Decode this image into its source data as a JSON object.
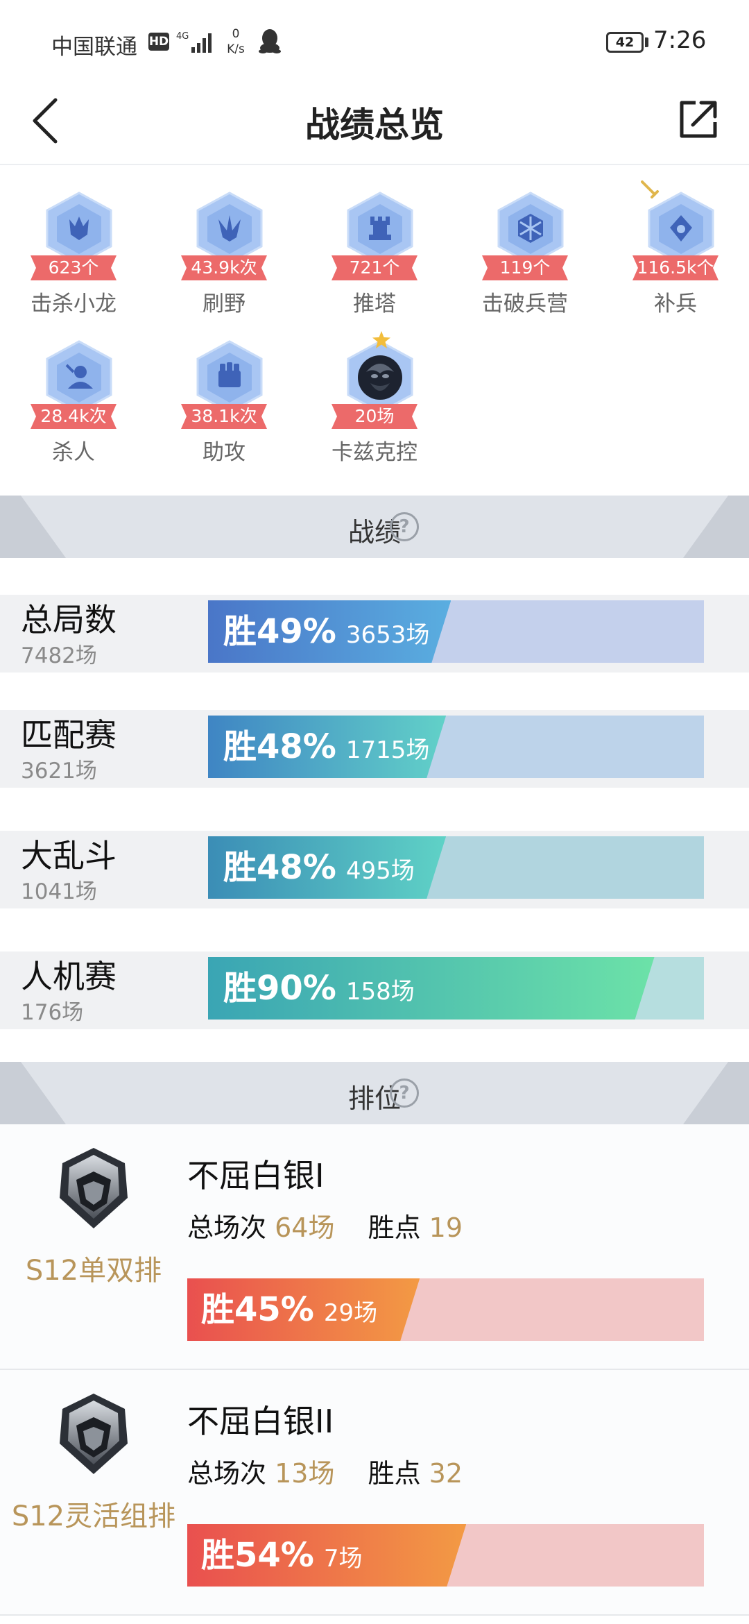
{
  "status_bar": {
    "carrier": "中国联通",
    "hd": "HD",
    "network_type": "4G",
    "net_speed_value": "0",
    "net_speed_unit": "K/s",
    "battery": "42",
    "time": "7:26"
  },
  "nav": {
    "title": "战绩总览"
  },
  "badges": [
    {
      "value": "623个",
      "label": "击杀小龙",
      "icon": "dragon-icon"
    },
    {
      "value": "43.9k次",
      "label": "刷野",
      "icon": "jungle-icon"
    },
    {
      "value": "721个",
      "label": "推塔",
      "icon": "tower-icon"
    },
    {
      "value": "119个",
      "label": "击破兵营",
      "icon": "barracks-icon"
    },
    {
      "value": "116.5k个",
      "label": "补兵",
      "icon": "minion-icon"
    },
    {
      "value": "28.4k次",
      "label": "杀人",
      "icon": "kill-icon"
    },
    {
      "value": "38.1k次",
      "label": "助攻",
      "icon": "assist-icon"
    },
    {
      "value": "20场",
      "label": "卡兹克控",
      "icon": "hero-portrait-icon"
    }
  ],
  "stats_section": {
    "title": "战绩",
    "rows": [
      {
        "name": "总局数",
        "total": "7482场",
        "win_label": "胜49%",
        "wins": "3653场",
        "win_rate": 0.49
      },
      {
        "name": "匹配赛",
        "total": "3621场",
        "win_label": "胜48%",
        "wins": "1715场",
        "win_rate": 0.48
      },
      {
        "name": "大乱斗",
        "total": "1041场",
        "win_label": "胜48%",
        "wins": "495场",
        "win_rate": 0.48
      },
      {
        "name": "人机赛",
        "total": "176场",
        "win_label": "胜90%",
        "wins": "158场",
        "win_rate": 0.9
      }
    ]
  },
  "rank_section": {
    "title": "排位",
    "rows": [
      {
        "season": "S12单双排",
        "rank": "不屈白银I",
        "games_label": "总场次",
        "games": "64场",
        "points_label": "胜点",
        "points": "19",
        "win_label": "胜45%",
        "wins": "29场",
        "win_rate": 0.45
      },
      {
        "season": "S12灵活组排",
        "rank": "不屈白银II",
        "games_label": "总场次",
        "games": "13场",
        "points_label": "胜点",
        "points": "32",
        "win_label": "胜54%",
        "wins": "7场",
        "win_rate": 0.54
      }
    ]
  },
  "colors": {
    "badge_hex": "#a9c6f3",
    "ribbon": "#ec6a6a",
    "rank_gold": "#b8955a",
    "section_bg": "#dfe3e9"
  }
}
